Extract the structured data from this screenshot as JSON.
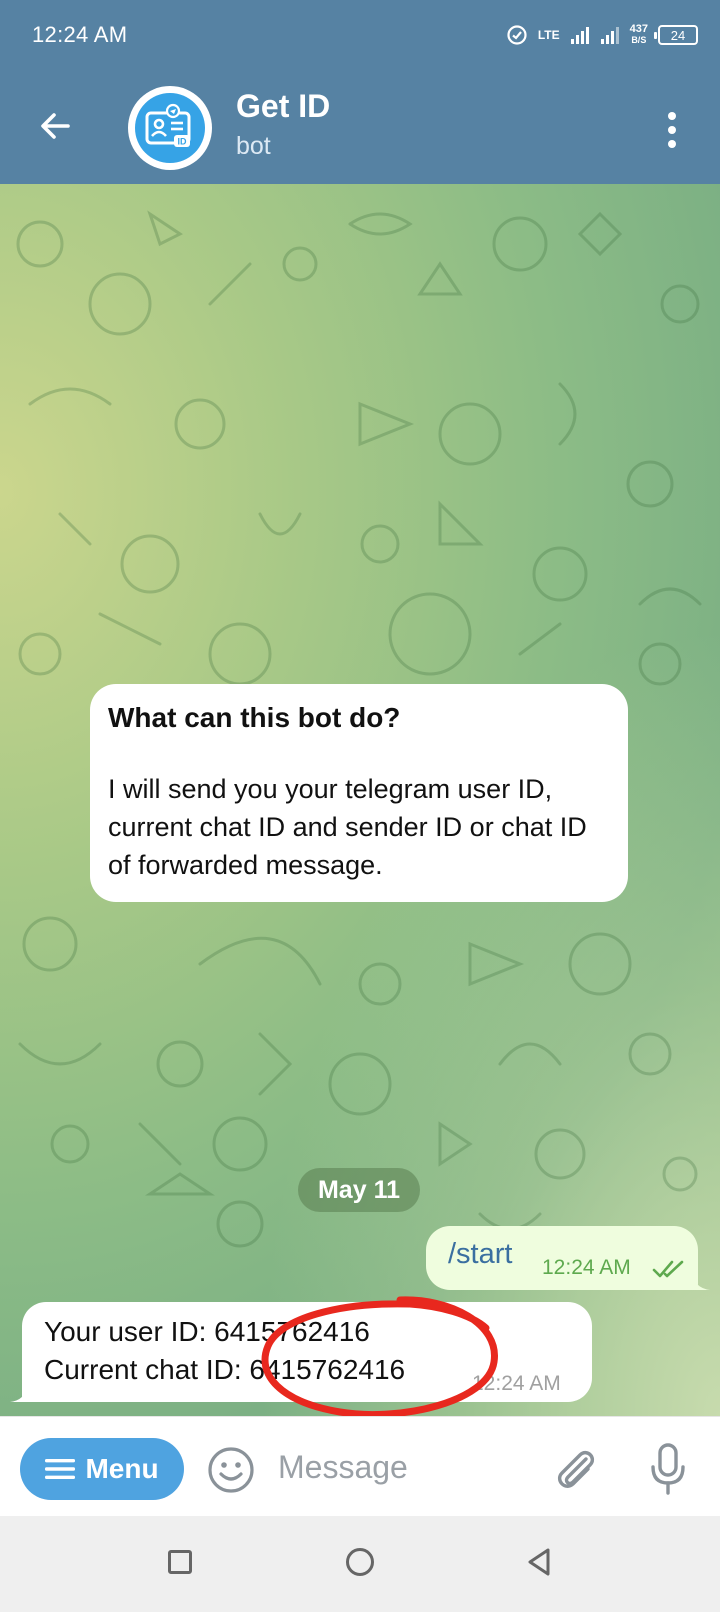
{
  "status_bar": {
    "time": "12:24 AM",
    "network": "LTE",
    "speed_value": "437",
    "speed_unit": "B/S",
    "battery": "24"
  },
  "header": {
    "title": "Get ID",
    "subtitle": "bot",
    "avatar_icon": "id-card-icon"
  },
  "chat": {
    "info_card": {
      "title": "What can this bot do?",
      "body": "I will send you your telegram user ID, current chat ID and sender ID or chat ID of forwarded message."
    },
    "date_label": "May 11",
    "outgoing": {
      "text": "/start",
      "time": "12:24 AM"
    },
    "incoming": {
      "line1": "Your user ID: 6415762416",
      "line2": "Current chat ID: 6415762416",
      "time": "12:24 AM"
    },
    "colors": {
      "outgoing_bubble": "#effdde",
      "incoming_bubble": "#ffffff",
      "annotation": "#e8281e"
    }
  },
  "composer": {
    "menu_label": "Menu",
    "placeholder": "Message"
  },
  "colors": {
    "header": "#5682a3",
    "accent": "#4fa3e0"
  }
}
